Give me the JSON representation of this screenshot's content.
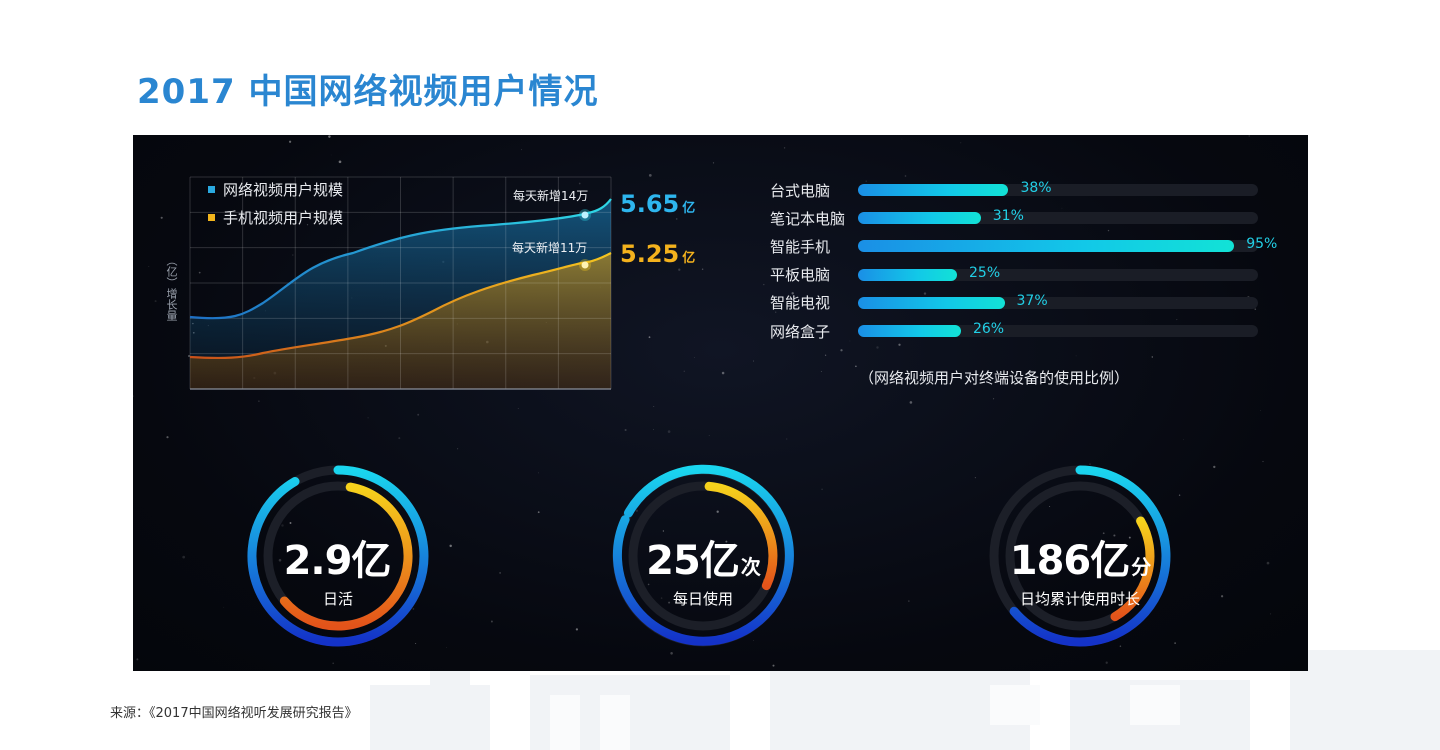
{
  "title": "2017 中国网络视频用户情况",
  "source": "来源：《2017中国网络视听发展研究报告》",
  "chart_data": [
    {
      "type": "area",
      "ylabel": "（亿）增长量",
      "series": [
        {
          "name": "网络视频用户规模",
          "color": "#2aa9e0",
          "end_value": "5.65",
          "unit": "亿",
          "callout": "每天新增14万"
        },
        {
          "name": "手机视频用户规模",
          "color": "#f2b51c",
          "end_value": "5.25",
          "unit": "亿",
          "callout": "每天新增11万"
        }
      ]
    },
    {
      "type": "bar",
      "caption": "（网络视频用户对终端设备的使用比例）",
      "categories": [
        "台式电脑",
        "笔记本电脑",
        "智能手机",
        "平板电脑",
        "智能电视",
        "网络盒子"
      ],
      "values": [
        38,
        31,
        95,
        25,
        37,
        26
      ],
      "labels": [
        "38%",
        "31%",
        "95%",
        "25%",
        "37%",
        "26%"
      ]
    }
  ],
  "stats": [
    {
      "value": "2.9亿",
      "suffix": "",
      "label": "日活"
    },
    {
      "value": "25亿",
      "suffix": "次",
      "label": "每日使用"
    },
    {
      "value": "186亿",
      "suffix": "分",
      "label": "日均累计使用时长"
    }
  ]
}
